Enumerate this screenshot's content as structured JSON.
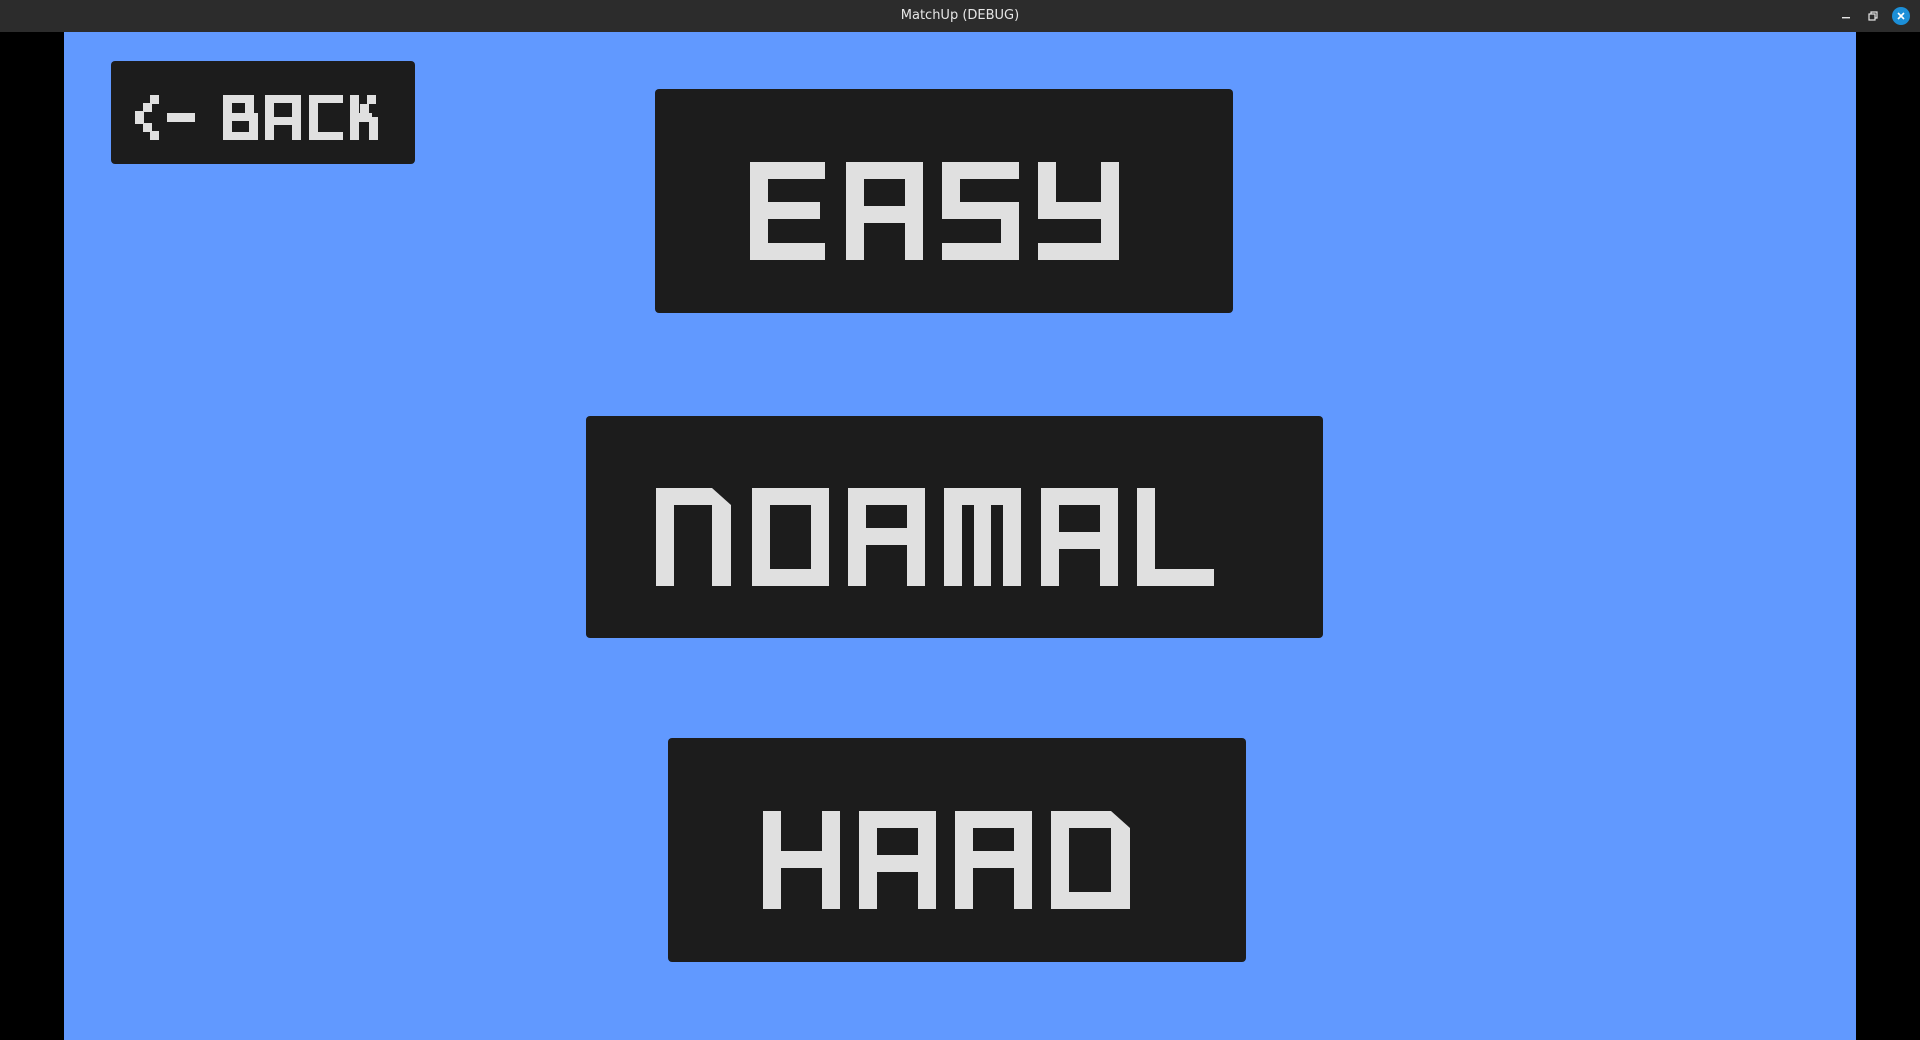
{
  "window": {
    "title": "MatchUp (DEBUG)",
    "controls": [
      "minimize-icon",
      "restore-icon",
      "close-icon"
    ]
  },
  "colors": {
    "background": "#6199ff",
    "button": "#1c1c1c",
    "button_text": "#e0e0e0",
    "titlebar": "#2c2c2c",
    "close_accent": "#1c8fd8"
  },
  "menu": {
    "back_label": "<- BACK",
    "easy_label": "EASY",
    "normal_label": "NORMAL",
    "hard_label": "HARD"
  }
}
